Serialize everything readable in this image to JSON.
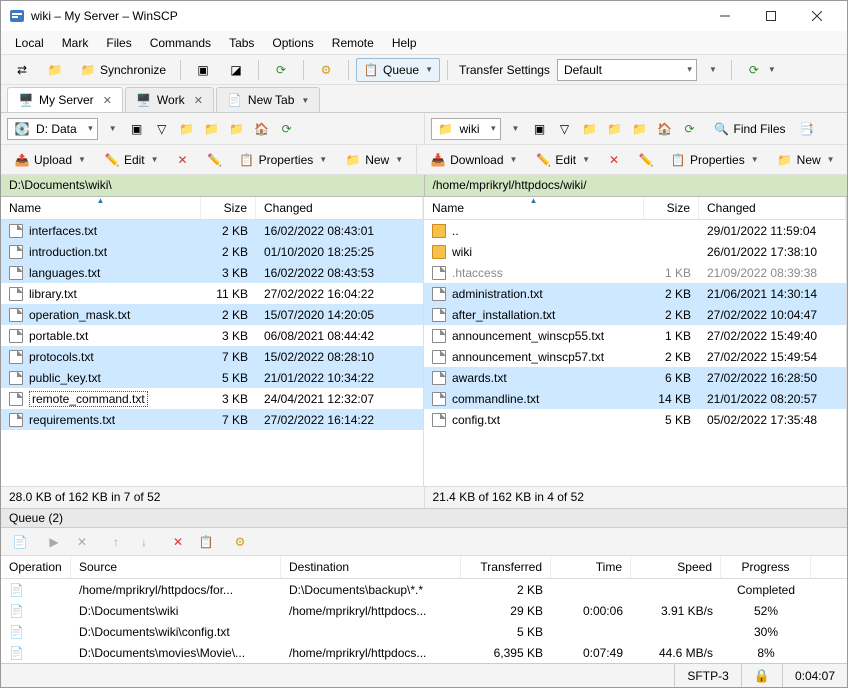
{
  "title": "wiki – My Server – WinSCP",
  "menu": [
    "Local",
    "Mark",
    "Files",
    "Commands",
    "Tabs",
    "Options",
    "Remote",
    "Help"
  ],
  "toolbar1": {
    "sync": "Synchronize",
    "queue": "Queue",
    "transfer_label": "Transfer Settings",
    "transfer_value": "Default"
  },
  "tabs": [
    {
      "label": "My Server",
      "active": true
    },
    {
      "label": "Work",
      "active": false
    },
    {
      "label": "New Tab",
      "active": false
    }
  ],
  "left": {
    "drive": "D: Data",
    "actions": {
      "upload": "Upload",
      "edit": "Edit",
      "properties": "Properties",
      "new": "New"
    },
    "path": "D:\\Documents\\wiki\\",
    "cols": {
      "name": "Name",
      "size": "Size",
      "changed": "Changed"
    },
    "files": [
      {
        "name": "interfaces.txt",
        "size": "2 KB",
        "changed": "16/02/2022 08:43:01",
        "sel": true
      },
      {
        "name": "introduction.txt",
        "size": "2 KB",
        "changed": "01/10/2020 18:25:25",
        "sel": true
      },
      {
        "name": "languages.txt",
        "size": "3 KB",
        "changed": "16/02/2022 08:43:53",
        "sel": true
      },
      {
        "name": "library.txt",
        "size": "11 KB",
        "changed": "27/02/2022 16:04:22",
        "sel": false
      },
      {
        "name": "operation_mask.txt",
        "size": "2 KB",
        "changed": "15/07/2020 14:20:05",
        "sel": true
      },
      {
        "name": "portable.txt",
        "size": "3 KB",
        "changed": "06/08/2021 08:44:42",
        "sel": false
      },
      {
        "name": "protocols.txt",
        "size": "7 KB",
        "changed": "15/02/2022 08:28:10",
        "sel": true
      },
      {
        "name": "public_key.txt",
        "size": "5 KB",
        "changed": "21/01/2022 10:34:22",
        "sel": true
      },
      {
        "name": "remote_command.txt",
        "size": "3 KB",
        "changed": "24/04/2021 12:32:07",
        "sel": false,
        "editing": true
      },
      {
        "name": "requirements.txt",
        "size": "7 KB",
        "changed": "27/02/2022 16:14:22",
        "sel": true
      }
    ],
    "status": "28.0 KB of 162 KB in 7 of 52"
  },
  "right": {
    "drive": "wiki",
    "find": "Find Files",
    "actions": {
      "download": "Download",
      "edit": "Edit",
      "properties": "Properties",
      "new": "New"
    },
    "path": "/home/mprikryl/httpdocs/wiki/",
    "cols": {
      "name": "Name",
      "size": "Size",
      "changed": "Changed"
    },
    "files": [
      {
        "name": "..",
        "size": "",
        "changed": "29/01/2022 11:59:04",
        "type": "up"
      },
      {
        "name": "wiki",
        "size": "",
        "changed": "26/01/2022 17:38:10",
        "type": "folder"
      },
      {
        "name": ".htaccess",
        "size": "1 KB",
        "changed": "21/09/2022 08:39:38",
        "grey": true
      },
      {
        "name": "administration.txt",
        "size": "2 KB",
        "changed": "21/06/2021 14:30:14",
        "sel": true
      },
      {
        "name": "after_installation.txt",
        "size": "2 KB",
        "changed": "27/02/2022 10:04:47",
        "sel": true
      },
      {
        "name": "announcement_winscp55.txt",
        "size": "1 KB",
        "changed": "27/02/2022 15:49:40"
      },
      {
        "name": "announcement_winscp57.txt",
        "size": "2 KB",
        "changed": "27/02/2022 15:49:54"
      },
      {
        "name": "awards.txt",
        "size": "6 KB",
        "changed": "27/02/2022 16:28:50",
        "sel": true
      },
      {
        "name": "commandline.txt",
        "size": "14 KB",
        "changed": "21/01/2022 08:20:57",
        "sel": true
      },
      {
        "name": "config.txt",
        "size": "5 KB",
        "changed": "05/02/2022 17:35:48"
      }
    ],
    "status": "21.4 KB of 162 KB in 4 of 52"
  },
  "queue": {
    "title": "Queue (2)",
    "cols": {
      "op": "Operation",
      "src": "Source",
      "dst": "Destination",
      "tr": "Transferred",
      "tm": "Time",
      "sp": "Speed",
      "pr": "Progress"
    },
    "rows": [
      {
        "src": "/home/mprikryl/httpdocs/for...",
        "dst": "D:\\Documents\\backup\\*.*",
        "tr": "2 KB",
        "tm": "",
        "sp": "",
        "pr": "Completed"
      },
      {
        "src": "D:\\Documents\\wiki",
        "dst": "/home/mprikryl/httpdocs...",
        "tr": "29 KB",
        "tm": "0:00:06",
        "sp": "3.91 KB/s",
        "pr": "52%"
      },
      {
        "src": "D:\\Documents\\wiki\\config.txt",
        "dst": "",
        "tr": "5 KB",
        "tm": "",
        "sp": "",
        "pr": "30%"
      },
      {
        "src": "D:\\Documents\\movies\\Movie\\...",
        "dst": "/home/mprikryl/httpdocs...",
        "tr": "6,395 KB",
        "tm": "0:07:49",
        "sp": "44.6 MB/s",
        "pr": "8%"
      }
    ]
  },
  "status": {
    "proto": "SFTP-3",
    "time": "0:04:07"
  }
}
